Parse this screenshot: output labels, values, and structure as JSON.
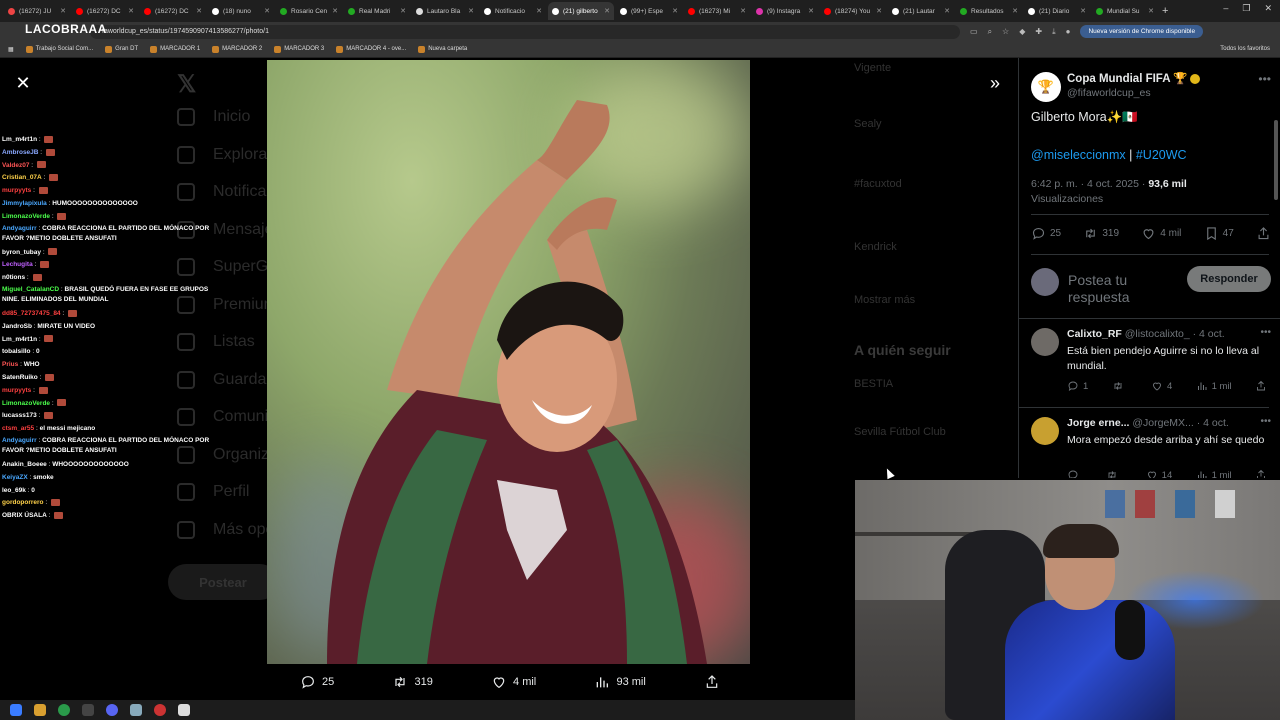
{
  "browser": {
    "tabs": [
      {
        "label": "(16272) JU",
        "color": "#e44"
      },
      {
        "label": "(16272) DC",
        "color": "#f00"
      },
      {
        "label": "(16272) DC",
        "color": "#f00"
      },
      {
        "label": "(18) nuno",
        "color": "#fff"
      },
      {
        "label": "Rosario Cen",
        "color": "#2a2"
      },
      {
        "label": "Real Madri",
        "color": "#2a2"
      },
      {
        "label": "Lautaro Bla",
        "color": "#ddd"
      },
      {
        "label": "Notificacio",
        "color": "#fff"
      },
      {
        "label": "(21) gilberto",
        "color": "#fff",
        "active": true
      },
      {
        "label": "(99+) Espe",
        "color": "#fff"
      },
      {
        "label": "(16273) Mi",
        "color": "#f00"
      },
      {
        "label": "(9) Instagra",
        "color": "#d3a"
      },
      {
        "label": "(18274) You",
        "color": "#f00"
      },
      {
        "label": "(21) Lautar",
        "color": "#fff"
      },
      {
        "label": "Resultados",
        "color": "#2a2"
      },
      {
        "label": "(21) Diario",
        "color": "#fff"
      },
      {
        "label": "Mundial Su",
        "color": "#2a2"
      }
    ],
    "url": "faworldcup_es/status/1974590907413586277/photo/1",
    "update_label": "Nueva versión de Chrome disponible",
    "bookmarks": [
      "Trabajo Social Com...",
      "Gran DT",
      "MARCADOR 1",
      "MARCADOR 2",
      "MARCADOR 3",
      "MARCADOR 4 - ove...",
      "Nueva carpeta"
    ],
    "all_bookmarks": "Todos los favoritos"
  },
  "stream": {
    "logo_text": "LACOBRAAA"
  },
  "background_page": {
    "nav": [
      "Inicio",
      "Explorar",
      "Notificaciones",
      "Mensajes",
      "SuperGrok",
      "Premium",
      "Listas",
      "Guardados",
      "Comunidades",
      "Organizaciones",
      "Perfil",
      "Más opciones"
    ],
    "post_label": "Postear",
    "right_items": [
      "Vigente",
      "Sealy",
      "#facuxtod",
      "Kendrick",
      "Mostrar más",
      "A quién seguir",
      "BESTIA",
      "Sevilla Fútbol Club"
    ]
  },
  "chat": [
    {
      "user": "Lm_m4rt1n",
      "color": "#fff",
      "msg": ""
    },
    {
      "user": "AmbroseJB",
      "color": "#8aa8ff",
      "msg": ""
    },
    {
      "user": "Valdez07",
      "color": "#ff5555",
      "msg": ""
    },
    {
      "user": "Cristian_07A",
      "color": "#ffd24a",
      "msg": ""
    },
    {
      "user": "murpyyts",
      "color": "#ff4040",
      "msg": ""
    },
    {
      "user": "Jimmylapixula",
      "color": "#4aa8ff",
      "msg": "HUMOOOOOOOOOOOOOO"
    },
    {
      "user": "LimonazoVerde",
      "color": "#4cff4c",
      "msg": ""
    },
    {
      "user": "Andyaguirr",
      "color": "#4aa8ff",
      "msg": "COBRA REACCIONA EL PARTIDO DEL MÓNACO POR FAVOR ?METIO DOBLETE ANSUFATI",
      "wrap": true
    },
    {
      "user": "byron_tubay",
      "color": "#fff",
      "msg": ""
    },
    {
      "user": "Lechugita",
      "color": "#c060ff",
      "msg": ""
    },
    {
      "user": "n0tions",
      "color": "#fff",
      "msg": ""
    },
    {
      "user": "Miguel_CatalanCD",
      "color": "#4cff4c",
      "msg": "BRASIL QUEDÓ FUERA EN FASE EE GRUPOS NINE. ELIMINADOS DEL MUNDIAL",
      "wrap": true
    },
    {
      "user": "dd85_72737475_84",
      "color": "#ff4040",
      "msg": ""
    },
    {
      "user": "JandroSb",
      "color": "#fff",
      "msg": "MIRATE UN VIDEO"
    },
    {
      "user": "Lm_m4rt1n",
      "color": "#fff",
      "msg": ""
    },
    {
      "user": "tobalsillo",
      "color": "#fff",
      "msg": "0"
    },
    {
      "user": "Prius",
      "color": "#ff5555",
      "msg": "WHO"
    },
    {
      "user": "SatenRuiko",
      "color": "#fff",
      "msg": ""
    },
    {
      "user": "murpyyts",
      "color": "#ff4040",
      "msg": ""
    },
    {
      "user": "LimonazoVerde",
      "color": "#4cff4c",
      "msg": ""
    },
    {
      "user": "lucasss173",
      "color": "#fff",
      "msg": ""
    },
    {
      "user": "ctsm_ar55",
      "color": "#ff4040",
      "msg": "el messi mejicano"
    },
    {
      "user": "Andyaguirr",
      "color": "#4aa8ff",
      "msg": "COBRA REACCIONA EL PARTIDO DEL MÓNACO POR FAVOR ?METIO DOBLETE ANSUFATI",
      "wrap": true
    },
    {
      "user": "Anakin_Boeee",
      "color": "#fff",
      "msg": "WHOOOOOOOOOOOOO"
    },
    {
      "user": "KeiyaZX",
      "color": "#4aa8ff",
      "msg": "smoke"
    },
    {
      "user": "leo_69k",
      "color": "#fff",
      "msg": "0"
    },
    {
      "user": "gordoporrero",
      "color": "#ffd24a",
      "msg": ""
    },
    {
      "user": "OBRIX ÚSALA",
      "color": "#fff",
      "msg": ""
    }
  ],
  "media_bar": {
    "replies": "25",
    "reposts": "319",
    "likes": "4 mil",
    "views": "93 mil"
  },
  "tweet": {
    "account_name": "Copa Mundial FIFA 🏆",
    "handle": "@fifaworldcup_es",
    "text": "Gilberto Mora✨🇲🇽",
    "link1": "@miseleccionmx",
    "link_sep": " | ",
    "link2": "#U20WC",
    "time": "6:42 p. m. · 4 oct. 2025 · ",
    "views": "93,6 mil",
    "views_label": "Visualizaciones",
    "replies": "25",
    "reposts": "319",
    "likes": "4 mil",
    "bookmarks": "47",
    "reply_placeholder": "Postea tu respuesta",
    "reply_button": "Responder"
  },
  "replies": [
    {
      "name": "Calixto_RF",
      "handle": "@listocalixto_ · 4 oct.",
      "text": "Está bien pendejo Aguirre si no lo lleva al mundial.",
      "replies": "1",
      "reposts": "",
      "likes": "4",
      "views": "1 mil"
    },
    {
      "name": "Jorge erne...",
      "handle": "@JorgeMX... · 4 oct.",
      "text": "Mora empezó desde arriba y ahí se quedo",
      "replies": "",
      "reposts": "",
      "likes": "14",
      "views": "1 mil"
    }
  ]
}
